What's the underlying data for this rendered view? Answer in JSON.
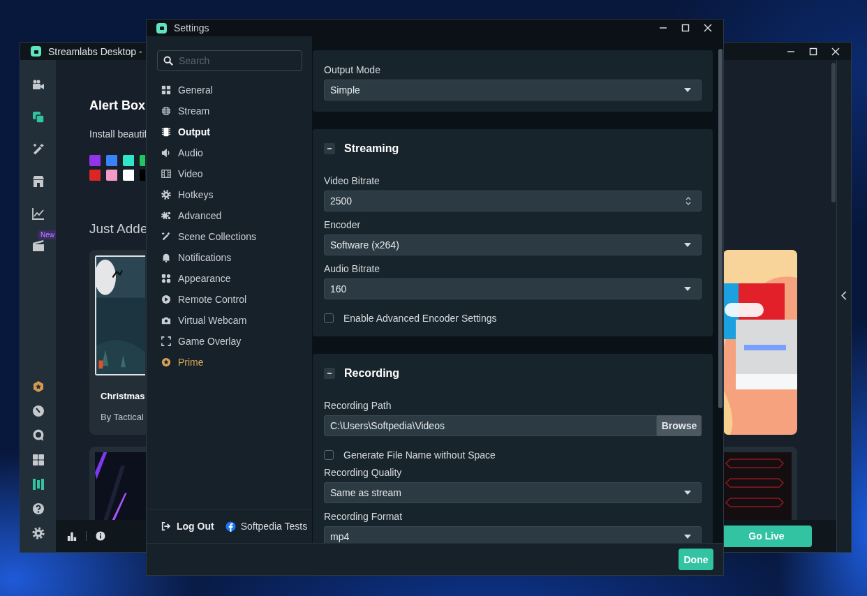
{
  "background_window": {
    "title": "Streamlabs Desktop -",
    "rail_top": [
      {
        "selected": false
      },
      {
        "selected": true
      },
      {
        "selected": false
      },
      {
        "selected": false
      },
      {
        "selected": false
      },
      {
        "selected": false,
        "badge": "New"
      }
    ],
    "rail_bottom": [
      {
        "selected": false
      },
      {
        "selected": false
      },
      {
        "selected": false
      },
      {
        "selected": false
      },
      {
        "selected": true
      },
      {
        "selected": false
      },
      {
        "selected": false
      }
    ],
    "heading": "Alert Box",
    "description": "Install beautif",
    "swatches": [
      {
        "color": "#9333ea"
      },
      {
        "color": "#3b82f6"
      },
      {
        "color": "#2ee6c8"
      },
      {
        "color": "#22c55e"
      },
      {
        "color": "#dc2626"
      },
      {
        "color": "#f49ac8"
      },
      {
        "color": "#ffffff"
      },
      {
        "color": "#000000"
      }
    ],
    "section_title": "Just Adde",
    "card": {
      "title": "Christmas",
      "author": "By Tactical"
    },
    "go_live": "Go Live"
  },
  "settings": {
    "title": "Settings",
    "search": {
      "placeholder": "Search"
    },
    "nav": [
      {
        "label": "General",
        "selected": false,
        "kind": "standard"
      },
      {
        "label": "Stream",
        "selected": false,
        "kind": "standard"
      },
      {
        "label": "Output",
        "selected": true,
        "kind": "standard"
      },
      {
        "label": "Audio",
        "selected": false,
        "kind": "standard"
      },
      {
        "label": "Video",
        "selected": false,
        "kind": "standard"
      },
      {
        "label": "Hotkeys",
        "selected": false,
        "kind": "standard"
      },
      {
        "label": "Advanced",
        "selected": false,
        "kind": "standard"
      },
      {
        "label": "Scene Collections",
        "selected": false,
        "kind": "standard"
      },
      {
        "label": "Notifications",
        "selected": false,
        "kind": "standard"
      },
      {
        "label": "Appearance",
        "selected": false,
        "kind": "standard"
      },
      {
        "label": "Remote Control",
        "selected": false,
        "kind": "standard"
      },
      {
        "label": "Virtual Webcam",
        "selected": false,
        "kind": "standard"
      },
      {
        "label": "Game Overlay",
        "selected": false,
        "kind": "standard"
      },
      {
        "label": "Prime",
        "selected": false,
        "kind": "premium"
      }
    ],
    "log_out": "Log Out",
    "account": "Softpedia Tests",
    "sections": [
      {
        "kind": "plain",
        "fields": [
          {
            "kind": "select",
            "label": "Output Mode",
            "value": "Simple"
          }
        ]
      },
      {
        "kind": "group",
        "title": "Streaming",
        "expanded": true,
        "fields": [
          {
            "kind": "number",
            "label": "Video Bitrate",
            "value": "2500"
          },
          {
            "kind": "select",
            "label": "Encoder",
            "value": "Software (x264)"
          },
          {
            "kind": "select",
            "label": "Audio Bitrate",
            "value": "160"
          },
          {
            "kind": "checkbox",
            "label": "Enable Advanced Encoder Settings",
            "checked": false
          }
        ]
      },
      {
        "kind": "group",
        "title": "Recording",
        "expanded": true,
        "fields": [
          {
            "kind": "path",
            "label": "Recording Path",
            "value": "C:\\Users\\Softpedia\\Videos",
            "button": "Browse"
          },
          {
            "kind": "checkbox",
            "label": "Generate File Name without Space",
            "checked": false
          },
          {
            "kind": "select",
            "label": "Recording Quality",
            "value": "Same as stream"
          },
          {
            "kind": "select",
            "label": "Recording Format",
            "value": "mp4"
          }
        ]
      }
    ],
    "done": "Done"
  }
}
